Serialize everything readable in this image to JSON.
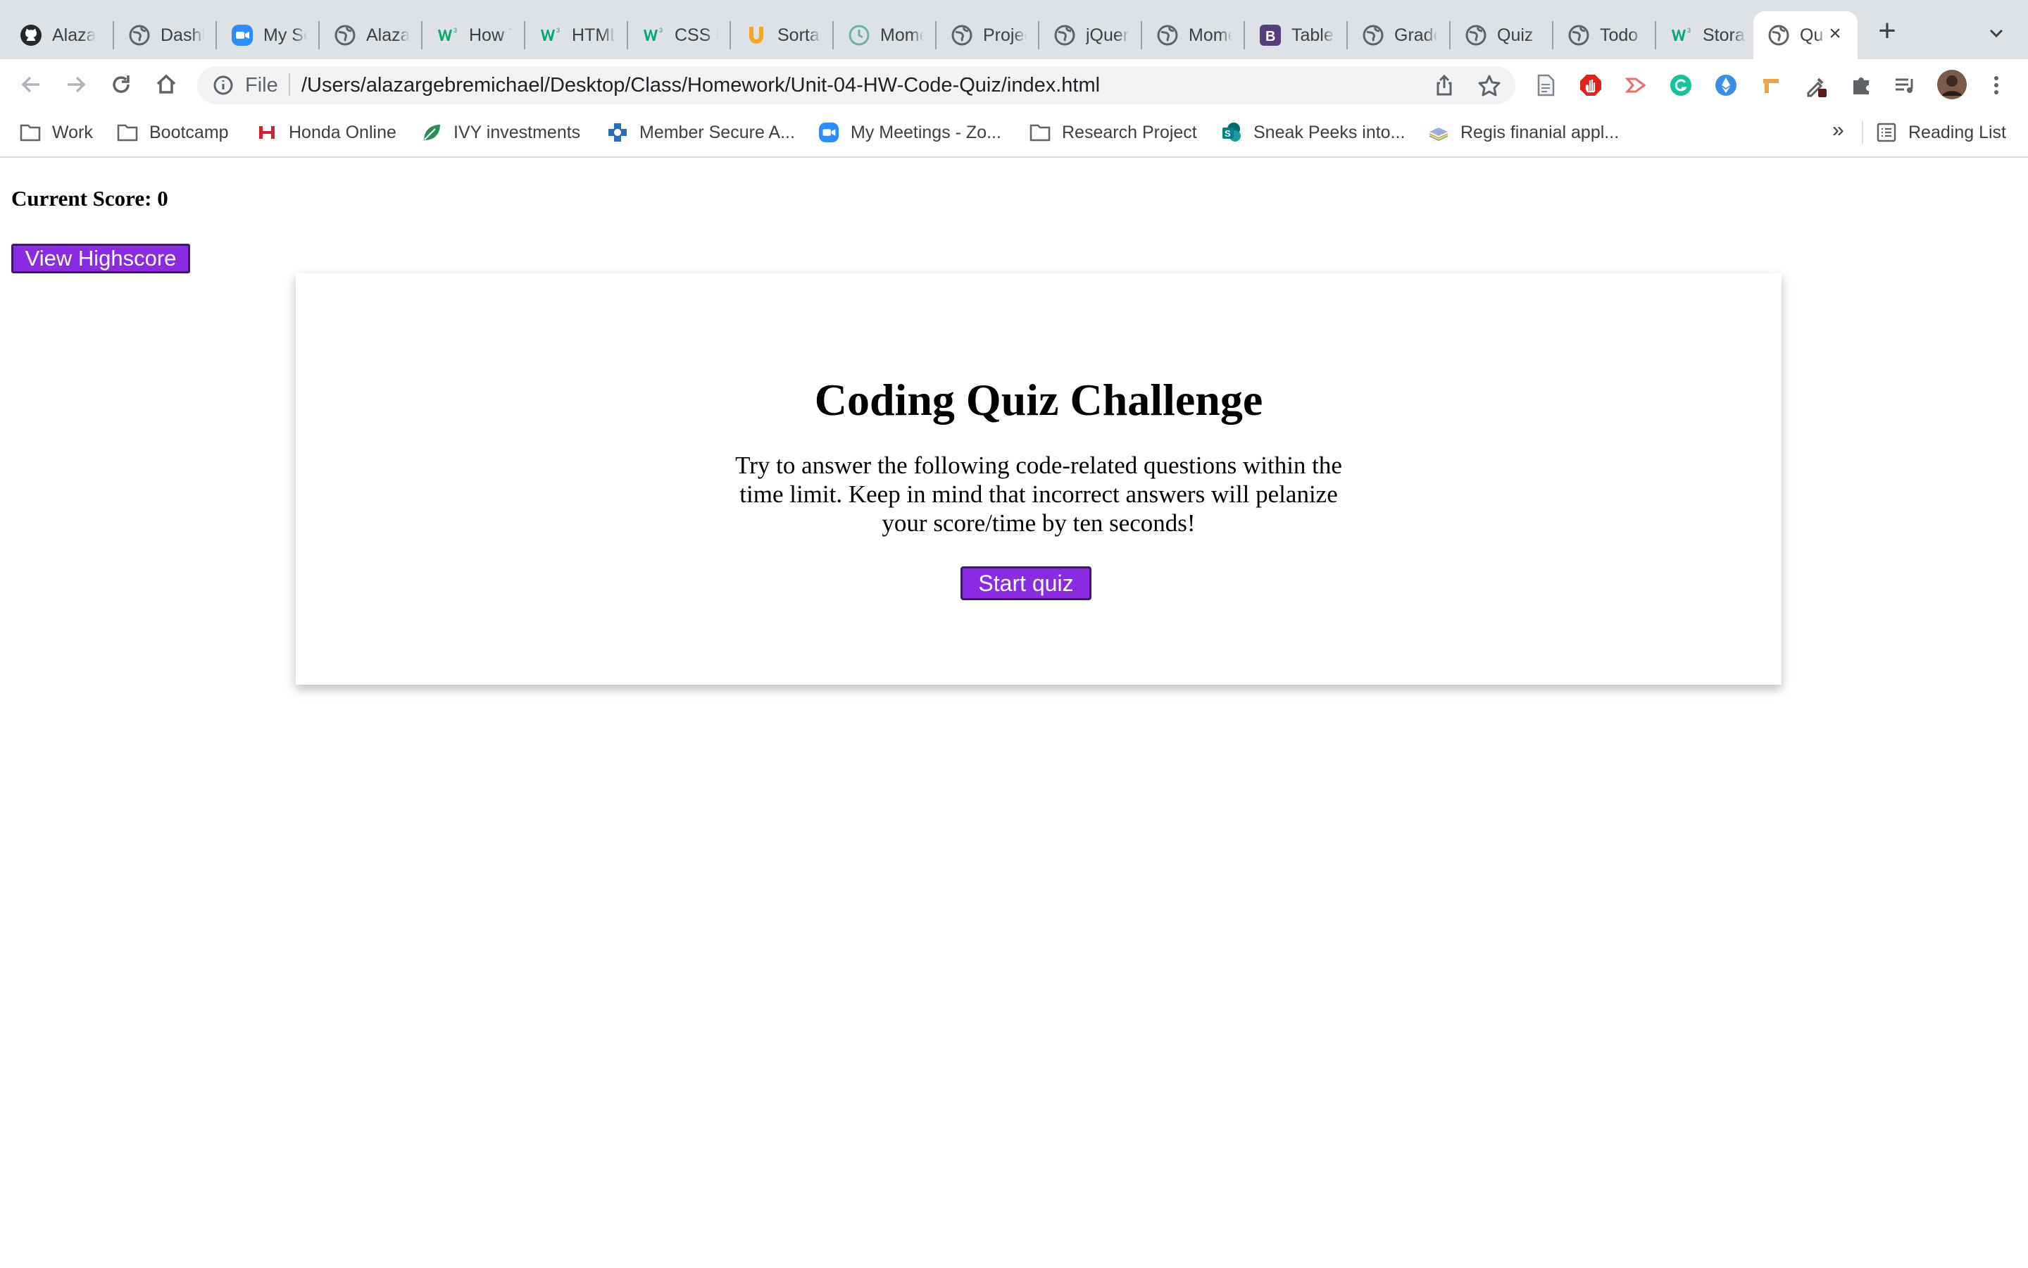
{
  "browser": {
    "tabs": [
      {
        "label": "Alazar",
        "icon": "github-icon"
      },
      {
        "label": "Dashb",
        "icon": "globe-icon"
      },
      {
        "label": "My Se",
        "icon": "zoom-icon"
      },
      {
        "label": "Alazar",
        "icon": "globe-icon"
      },
      {
        "label": "How T",
        "icon": "w3schools-icon"
      },
      {
        "label": "HTML",
        "icon": "w3schools-icon"
      },
      {
        "label": "CSS L",
        "icon": "w3schools-icon"
      },
      {
        "label": "Sortal",
        "icon": "sortable-icon"
      },
      {
        "label": "Mome",
        "icon": "clock-icon"
      },
      {
        "label": "Projec",
        "icon": "globe-icon"
      },
      {
        "label": "jQuery",
        "icon": "globe-icon"
      },
      {
        "label": "Mome",
        "icon": "globe-icon"
      },
      {
        "label": "Tables",
        "icon": "bootstrap-icon"
      },
      {
        "label": "Grade",
        "icon": "globe-icon"
      },
      {
        "label": "Quiz",
        "icon": "globe-icon"
      },
      {
        "label": "Todo",
        "icon": "globe-icon"
      },
      {
        "label": "Stora",
        "icon": "w3schools-icon"
      }
    ],
    "active_tab": {
      "label": "Qu",
      "icon": "globe-icon"
    },
    "address": {
      "scheme_label": "File",
      "url": "/Users/alazargebremichael/Desktop/Class/Homework/Unit-04-HW-Code-Quiz/index.html"
    },
    "bookmarks": [
      {
        "label": "Work",
        "icon": "folder-icon"
      },
      {
        "label": "Bootcamp",
        "icon": "folder-icon"
      },
      {
        "label": "Honda Online",
        "icon": "honda-icon"
      },
      {
        "label": "IVY investments",
        "icon": "leaf-icon"
      },
      {
        "label": "Member Secure A...",
        "icon": "bluecross-icon"
      },
      {
        "label": "My Meetings - Zo...",
        "icon": "zoom-icon"
      },
      {
        "label": "Research Project",
        "icon": "folder-icon"
      },
      {
        "label": "Sneak Peeks into...",
        "icon": "sharepoint-icon"
      },
      {
        "label": "Regis finanial appl...",
        "icon": "layers-icon"
      }
    ],
    "more_label": "»",
    "reading_list_label": "Reading List"
  },
  "page": {
    "score_label": "Current Score: 0",
    "highscore_button": "View Highscore",
    "title": "Coding Quiz Challenge",
    "description": "Try to answer the following code-related questions within the time limit. Keep in mind that incorrect answers will pelanize your score/time by ten seconds!",
    "start_button": "Start quiz"
  },
  "colors": {
    "accent": "#8a2be2",
    "tabstrip": "#dee1e6"
  }
}
